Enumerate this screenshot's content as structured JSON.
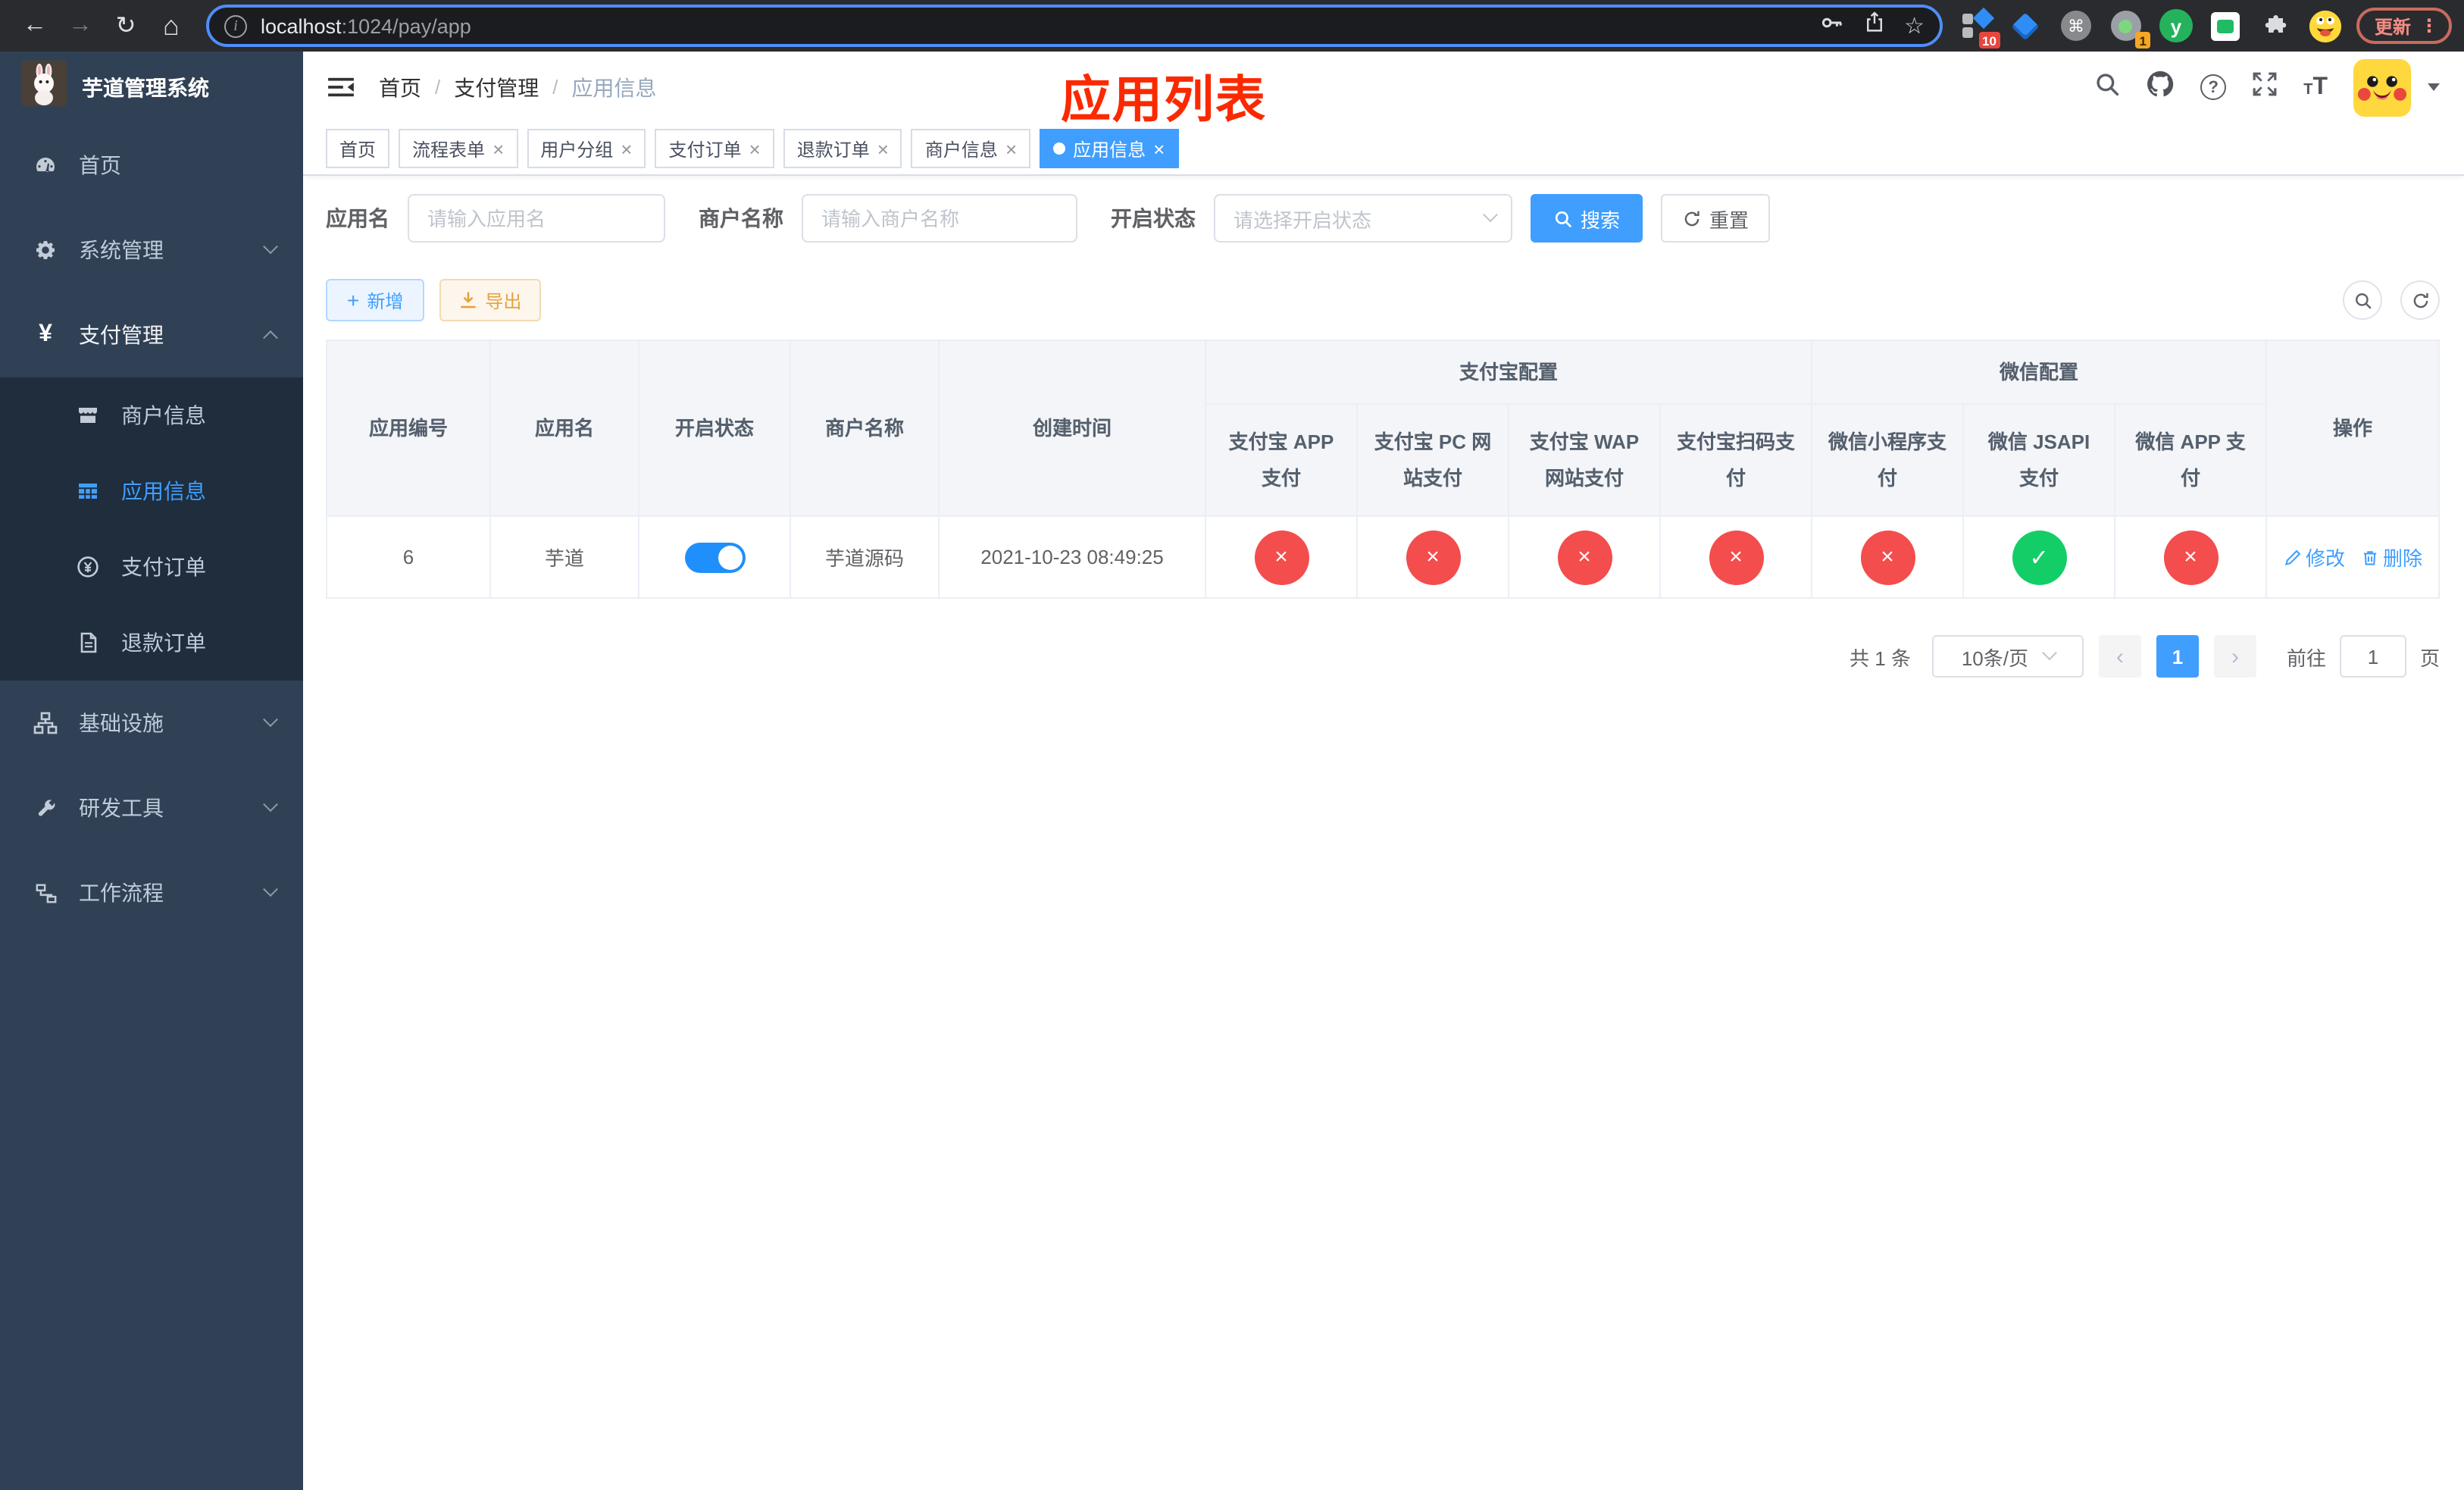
{
  "browser": {
    "url_host": "localhost",
    "url_path": ":1024/pay/app",
    "update_label": "更新",
    "ext_badge_sidebar": "10",
    "ext_badge_recorder": "1",
    "ext_y_letter": "y"
  },
  "sidebar": {
    "title": "芋道管理系统",
    "items": [
      {
        "label": "首页"
      },
      {
        "label": "系统管理"
      },
      {
        "label": "支付管理"
      },
      {
        "label": "基础设施"
      },
      {
        "label": "研发工具"
      },
      {
        "label": "工作流程"
      }
    ],
    "payment_submenu": [
      {
        "label": "商户信息"
      },
      {
        "label": "应用信息"
      },
      {
        "label": "支付订单"
      },
      {
        "label": "退款订单"
      }
    ]
  },
  "navbar": {
    "breadcrumb": [
      "首页",
      "支付管理",
      "应用信息"
    ],
    "overlay_title": "应用列表"
  },
  "tabs": [
    {
      "label": "首页",
      "closable": false,
      "active": false
    },
    {
      "label": "流程表单",
      "closable": true,
      "active": false
    },
    {
      "label": "用户分组",
      "closable": true,
      "active": false
    },
    {
      "label": "支付订单",
      "closable": true,
      "active": false
    },
    {
      "label": "退款订单",
      "closable": true,
      "active": false
    },
    {
      "label": "商户信息",
      "closable": true,
      "active": false
    },
    {
      "label": "应用信息",
      "closable": true,
      "active": true
    }
  ],
  "filters": {
    "app_name_label": "应用名",
    "app_name_placeholder": "请输入应用名",
    "merchant_label": "商户名称",
    "merchant_placeholder": "请输入商户名称",
    "status_label": "开启状态",
    "status_placeholder": "请选择开启状态",
    "search_label": "搜索",
    "reset_label": "重置"
  },
  "toolbar": {
    "add_label": "新增",
    "export_label": "导出"
  },
  "table": {
    "headers": {
      "app_id": "应用编号",
      "app_name": "应用名",
      "status": "开启状态",
      "merchant": "商户名称",
      "created": "创建时间",
      "alipay_group": "支付宝配置",
      "alipay_cols": [
        "支付宝 APP 支付",
        "支付宝 PC 网站支付",
        "支付宝 WAP 网站支付",
        "支付宝扫码支付"
      ],
      "wechat_group": "微信配置",
      "wechat_cols": [
        "微信小程序支付",
        "微信 JSAPI 支付",
        "微信 APP 支付"
      ],
      "ops": "操作"
    },
    "row": {
      "app_id": "6",
      "app_name": "芋道",
      "enabled": true,
      "merchant": "芋道源码",
      "created": "2021-10-23 08:49:25",
      "statuses": [
        false,
        false,
        false,
        false,
        false,
        true,
        false
      ],
      "edit_label": "修改",
      "delete_label": "删除"
    }
  },
  "pagination": {
    "total": "共 1 条",
    "page_size": "10条/页",
    "current_page": "1",
    "goto_label": "前往",
    "goto_value": "1",
    "page_label": "页"
  },
  "colors": {
    "primary": "#409eff",
    "sidebar_bg": "#304156",
    "submenu_bg": "#1f2d3d",
    "danger_circle": "#f34d4d",
    "success_circle": "#13ce66",
    "annotation_red": "#fb2900"
  }
}
